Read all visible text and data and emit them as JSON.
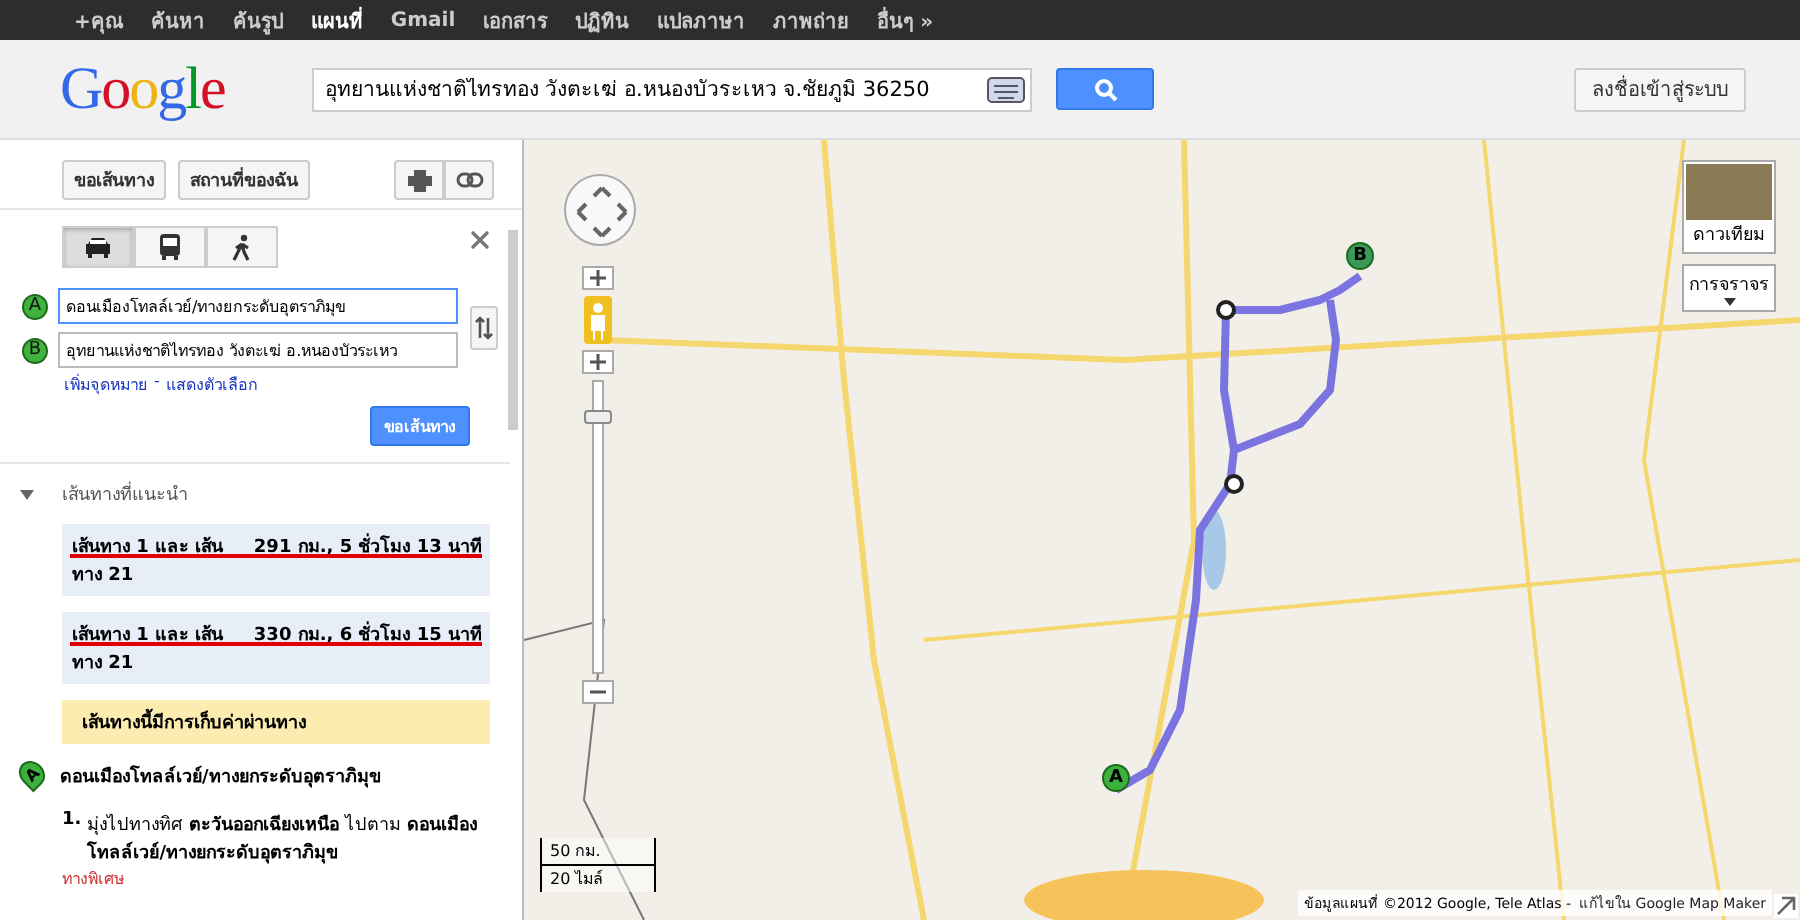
{
  "top_nav": [
    {
      "label": "+คุณ",
      "selected": false
    },
    {
      "label": "ค้นหา",
      "selected": false
    },
    {
      "label": "ค้นรูป",
      "selected": false
    },
    {
      "label": "แผนที่",
      "selected": true
    },
    {
      "label": "Gmail",
      "selected": false
    },
    {
      "label": "เอกสาร",
      "selected": false
    },
    {
      "label": "ปฏิทิน",
      "selected": false
    },
    {
      "label": "แปลภาษา",
      "selected": false
    },
    {
      "label": "ภาพถ่าย",
      "selected": false
    },
    {
      "label": "อื่นๆ »",
      "selected": false
    }
  ],
  "logo": "Google",
  "search": {
    "value": "อุทยานแห่งชาติไทรทอง วังตะเฆ่ อ.หนองบัวระเหว จ.ชัยภูมิ 36250"
  },
  "sign_in_button": "ลงชื่อเข้าสู่ระบบ",
  "panel": {
    "buttons": [
      "ขอเส้นทาง",
      "สถานที่ของฉัน"
    ],
    "travel_modes": [
      {
        "kind": "car",
        "selected": true
      },
      {
        "kind": "bus",
        "selected": false
      },
      {
        "kind": "walk",
        "selected": false
      }
    ],
    "waypoints": [
      {
        "marker": "A",
        "value": "ดอนเมืองโทลล์เวย์/ทางยกระดับอุตราภิมุข"
      },
      {
        "marker": "B",
        "value": "อุทยานแห่งชาติไทรทอง วังตะเฆ่ อ.หนองบัวระเหว"
      }
    ],
    "add_destination": "เพิ่มจุดหมาย",
    "separator": "-",
    "show_options": "แสดงตัวเลือก",
    "submit": "ขอเส้นทาง",
    "suggested_heading": "เส้นทางที่แนะนำ",
    "routes": [
      {
        "name": "เส้นทาง 1 และ เส้นทาง 21",
        "summary": "291 กม., 5 ชั่วโมง 13 นาที",
        "underlined": true
      },
      {
        "name": "เส้นทาง 1 และ เส้นทาง 21",
        "summary": "330 กม., 6 ชั่วโมง 15 นาที",
        "underlined": true
      }
    ],
    "toll_notice": "เส้นทางนี้มีการเก็บค่าผ่านทาง",
    "start": {
      "marker": "A",
      "name": "ดอนเมืองโทลล์เวย์/ทางยกระดับอุตราภิมุข"
    },
    "steps": [
      {
        "number": "1.",
        "text": "มุ่งไปทางทิศ **ตะวันออกเฉียงเหนือ** ไปตาม **ดอนเมืองโทลล์เวย์/ทางยกระดับอุตราภิมุข**",
        "note": "ทางพิเศษ"
      }
    ]
  },
  "map": {
    "zoom": {
      "level": 0.88
    },
    "satellite_button": "ดาวเทียม",
    "traffic_button": "การจราจร",
    "scale": [
      "50 กม.",
      "20 ไมล์"
    ],
    "markers": [
      {
        "label": "B",
        "kind": "end"
      },
      {
        "label": "A",
        "kind": "start"
      }
    ],
    "attribution": "ข้อมูลแผนที่ ©2012 Google, Tele Atlas -",
    "edit_link": "แก้ไขใน Google Map Maker"
  }
}
